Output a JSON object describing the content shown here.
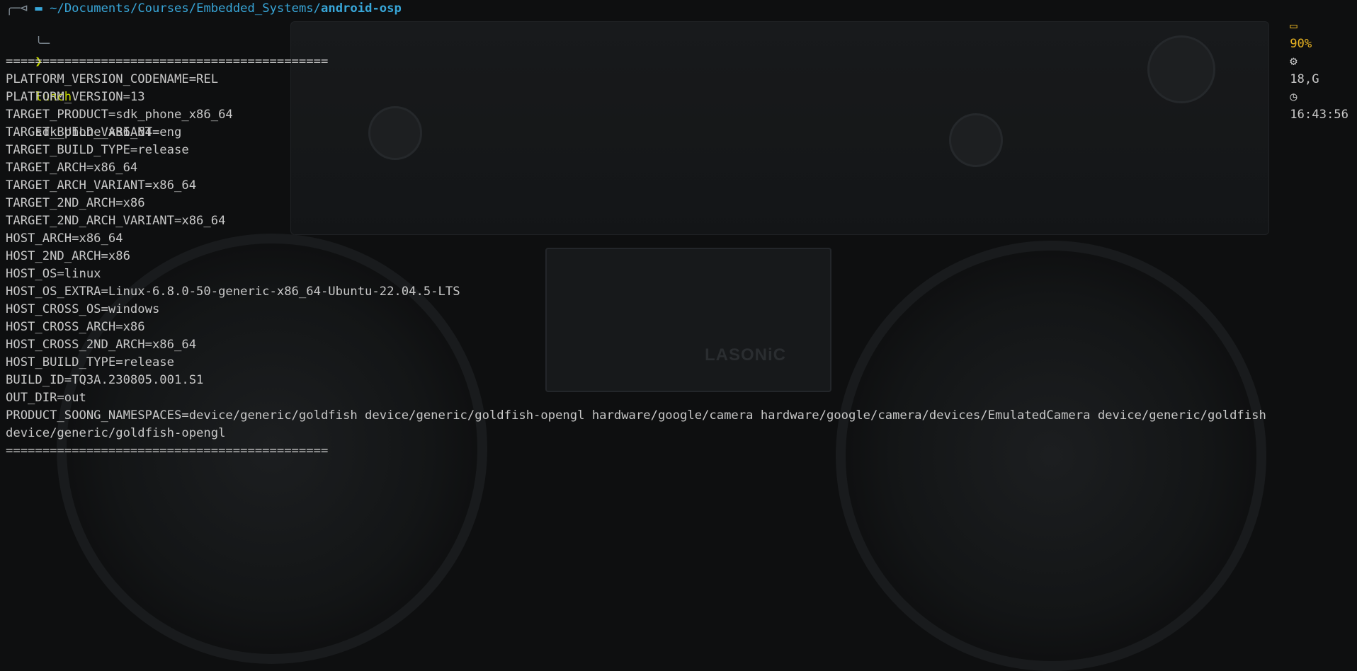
{
  "prompt": {
    "corner_top": "╭─",
    "git_glyph": "⊲",
    "folder_glyph": "▬",
    "path_base": "~/Documents/Courses/Embedded_Systems/",
    "path_dir": "android-osp",
    "corner_bottom": "╰─",
    "arrow": "❯",
    "command": "lunch",
    "argument": "sdk_phone_x86_64"
  },
  "status": {
    "battery_icon": "▭",
    "battery": "90%",
    "cpu_icon": "⚙",
    "load": "18,G",
    "clock_icon": "◷",
    "time": "16:43:56"
  },
  "output": [
    "",
    "============================================",
    "PLATFORM_VERSION_CODENAME=REL",
    "PLATFORM_VERSION=13",
    "TARGET_PRODUCT=sdk_phone_x86_64",
    "TARGET_BUILD_VARIANT=eng",
    "TARGET_BUILD_TYPE=release",
    "TARGET_ARCH=x86_64",
    "TARGET_ARCH_VARIANT=x86_64",
    "TARGET_2ND_ARCH=x86",
    "TARGET_2ND_ARCH_VARIANT=x86_64",
    "HOST_ARCH=x86_64",
    "HOST_2ND_ARCH=x86",
    "HOST_OS=linux",
    "HOST_OS_EXTRA=Linux-6.8.0-50-generic-x86_64-Ubuntu-22.04.5-LTS",
    "HOST_CROSS_OS=windows",
    "HOST_CROSS_ARCH=x86",
    "HOST_CROSS_2ND_ARCH=x86_64",
    "HOST_BUILD_TYPE=release",
    "BUILD_ID=TQ3A.230805.001.S1",
    "OUT_DIR=out",
    "PRODUCT_SOONG_NAMESPACES=device/generic/goldfish device/generic/goldfish-opengl hardware/google/camera hardware/google/camera/devices/EmulatedCamera device/generic/goldfish",
    "device/generic/goldfish-opengl",
    "============================================"
  ],
  "wallpaper": {
    "brand": "LASONiC"
  }
}
